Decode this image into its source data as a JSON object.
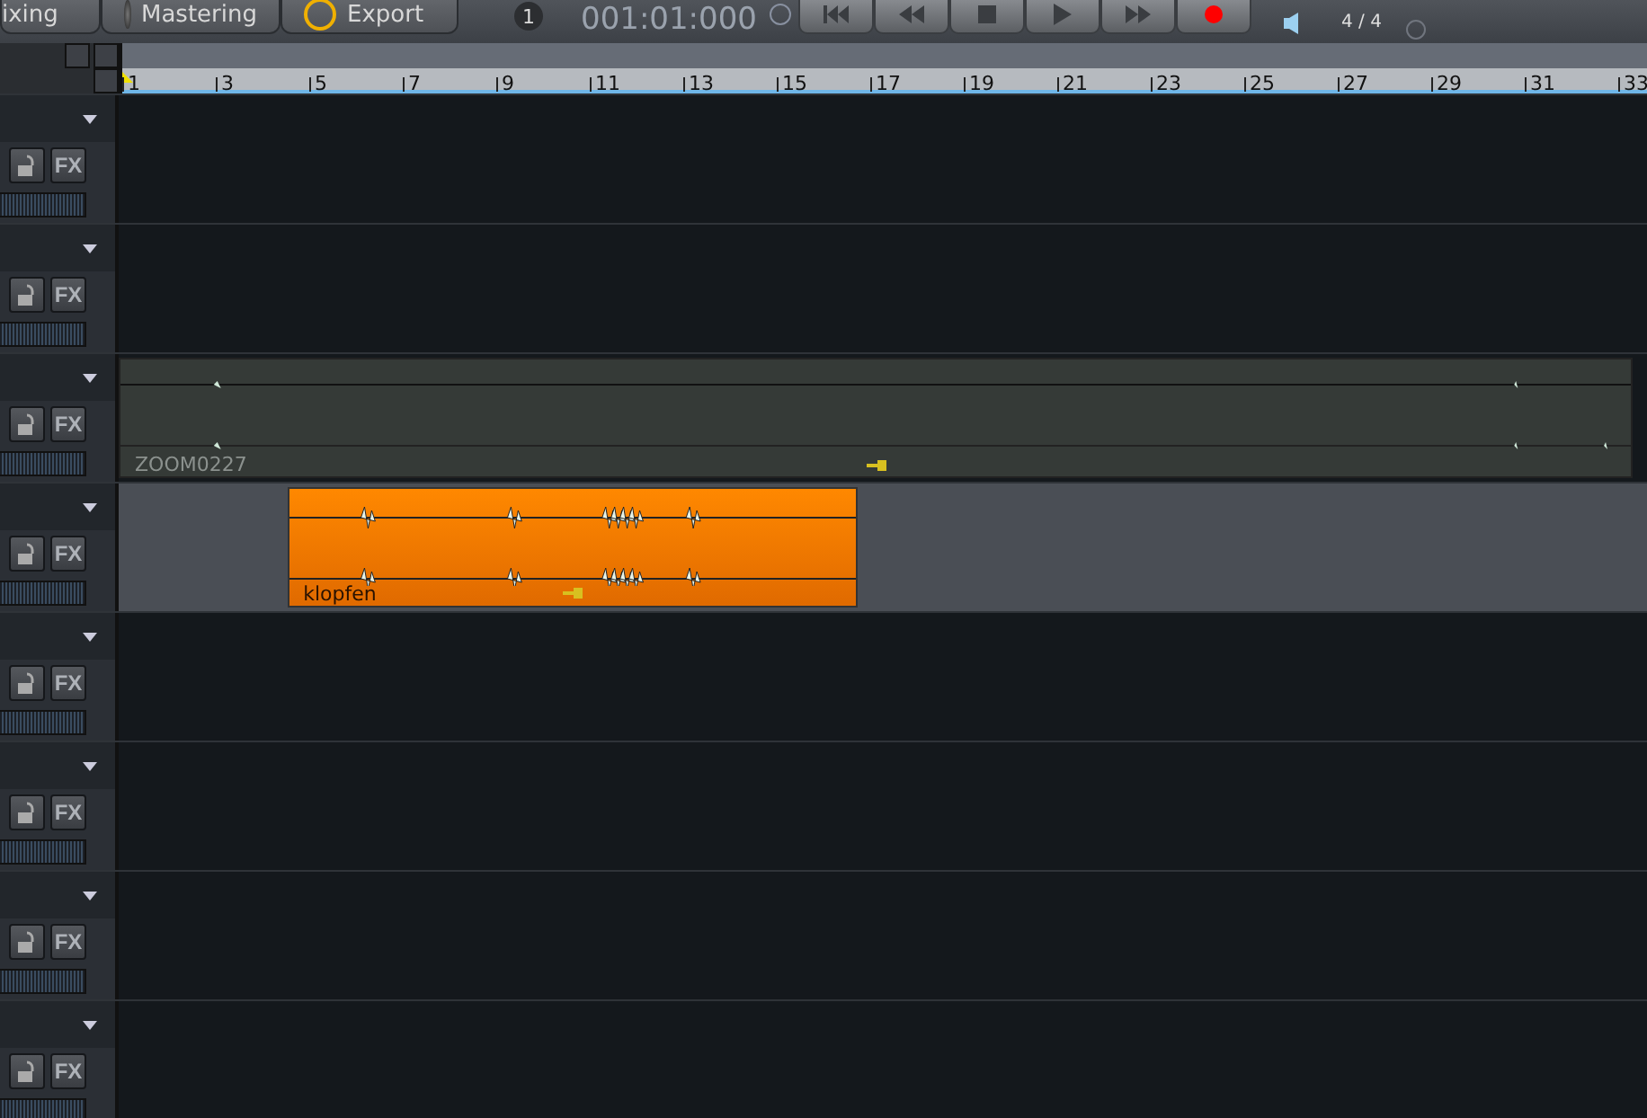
{
  "toolbar": {
    "tabs": [
      {
        "label": "ixing",
        "kind": "plain"
      },
      {
        "label": "Mastering",
        "kind": "knob"
      },
      {
        "label": "Export",
        "kind": "export"
      }
    ],
    "marker": "1",
    "position": "001:01:000",
    "transport": [
      {
        "kind": "start"
      },
      {
        "kind": "rewind"
      },
      {
        "kind": "stop"
      },
      {
        "kind": "play"
      },
      {
        "kind": "forward"
      },
      {
        "kind": "record"
      }
    ],
    "time_signature": "4 / 4"
  },
  "ruler": {
    "labels": [
      "1",
      "3",
      "5",
      "7",
      "9",
      "11",
      "13",
      "15",
      "17",
      "19",
      "21",
      "23",
      "25",
      "27",
      "29",
      "31",
      "33"
    ]
  },
  "tracks": [
    {
      "selected": false,
      "fx_label": "FX"
    },
    {
      "selected": false,
      "fx_label": "FX"
    },
    {
      "selected": false,
      "fx_label": "FX",
      "clip": {
        "name": "ZOOM0227",
        "kind": "dim"
      }
    },
    {
      "selected": true,
      "fx_label": "FX",
      "clip": {
        "name": "klopfen",
        "kind": "orange"
      }
    },
    {
      "selected": false,
      "fx_label": "FX"
    },
    {
      "selected": false,
      "fx_label": "FX"
    },
    {
      "selected": false,
      "fx_label": "FX"
    },
    {
      "selected": false,
      "fx_label": "FX"
    }
  ]
}
